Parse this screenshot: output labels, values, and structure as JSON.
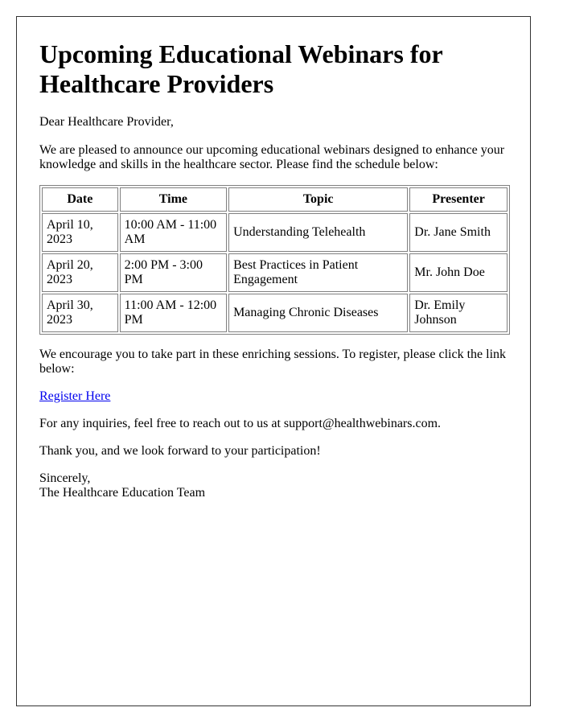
{
  "letter": {
    "title": "Upcoming Educational Webinars for Healthcare Providers",
    "greeting": "Dear Healthcare Provider,",
    "intro": "We are pleased to announce our upcoming educational webinars designed to enhance your knowledge and skills in the healthcare sector. Please find the schedule below:",
    "schedule": {
      "headers": [
        "Date",
        "Time",
        "Topic",
        "Presenter"
      ],
      "rows": [
        {
          "date": "April 10, 2023",
          "time": "10:00 AM - 11:00 AM",
          "topic": "Understanding Telehealth",
          "presenter": "Dr. Jane Smith"
        },
        {
          "date": "April 20, 2023",
          "time": "2:00 PM - 3:00 PM",
          "topic": "Best Practices in Patient Engagement",
          "presenter": "Mr. John Doe"
        },
        {
          "date": "April 30, 2023",
          "time": "11:00 AM - 12:00 PM",
          "topic": "Managing Chronic Diseases",
          "presenter": "Dr. Emily Johnson"
        }
      ]
    },
    "encourage": "We encourage you to take part in these enriching sessions. To register, please click the link below:",
    "register_link": "Register Here",
    "inquiries": "For any inquiries, feel free to reach out to us at support@healthwebinars.com.",
    "thanks": "Thank you, and we look forward to your participation!",
    "closing": "Sincerely,",
    "signature": "The Healthcare Education Team"
  },
  "colors": {
    "link": "#0000ee",
    "text": "#000000",
    "border": "#808080"
  }
}
